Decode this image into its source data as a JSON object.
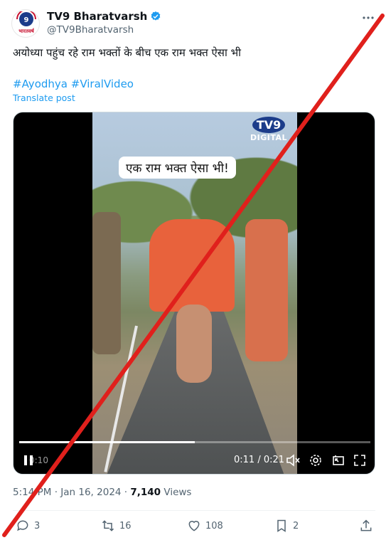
{
  "author": {
    "display_name": "TV9 Bharatvarsh",
    "handle": "@TV9Bharatvarsh",
    "avatar_text": "भारतवर्ष"
  },
  "post": {
    "text": "अयोध्या पहुंच रहे राम भक्तों के बीच एक राम भक्त ऐसा भी",
    "hashtags": [
      "#Ayodhya",
      "#ViralVideo"
    ],
    "translate_label": "Translate post"
  },
  "video": {
    "watermark_brand": "TV9",
    "watermark_sub": "DIGITAL",
    "caption": "एक राम भक्त ऐसा भी!",
    "time": "0:11 / 0:21",
    "progress": 0.5,
    "faded_label": "0:10"
  },
  "meta": {
    "time": "5:14 PM",
    "date": "Jan 16, 2024",
    "views": "7,140",
    "views_label": "Views"
  },
  "actions": {
    "replies": "3",
    "reposts": "16",
    "likes": "108",
    "bookmarks": "2"
  },
  "colors": {
    "accent": "#1d9bf0",
    "slash": "#e0201c",
    "text_secondary": "#536471"
  }
}
